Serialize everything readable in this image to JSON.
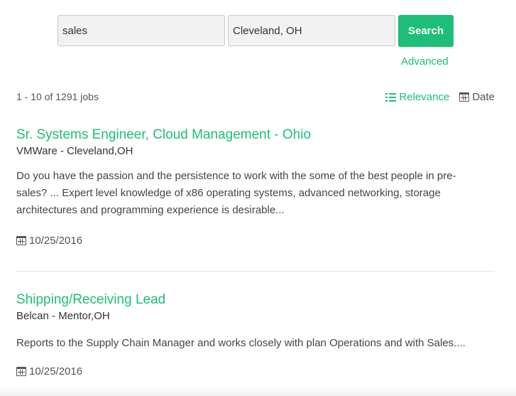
{
  "search": {
    "keyword_value": "sales",
    "location_value": "Cleveland, OH",
    "button_label": "Search",
    "advanced_label": "Advanced"
  },
  "results": {
    "count_text": "1 - 10 of 1291 jobs",
    "sort_relevance": "Relevance",
    "sort_date": "Date",
    "active_sort": "Relevance"
  },
  "jobs": [
    {
      "title": "Sr. Systems Engineer, Cloud Management - Ohio",
      "company_location": "VMWare - Cleveland,OH",
      "description": "Do you have the passion and the persistence to work with the some of the best people in pre-sales? ... Expert level knowledge of x86 operating systems, advanced networking, storage architectures and programming experience is desirable...",
      "date": "10/25/2016"
    },
    {
      "title": "Shipping/Receiving Lead",
      "company_location": "Belcan - Mentor,OH",
      "description": "Reports to the Supply Chain Manager and works closely with plan Operations and with Sales....",
      "date": "10/25/2016"
    }
  ],
  "colors": {
    "accent": "#1fbd7a",
    "input_bg": "#f2f2f2",
    "text": "#3f3f3f"
  },
  "icons": {
    "sort_relevance": "list-icon",
    "sort_date": "calendar-icon",
    "job_date": "calendar-icon"
  }
}
